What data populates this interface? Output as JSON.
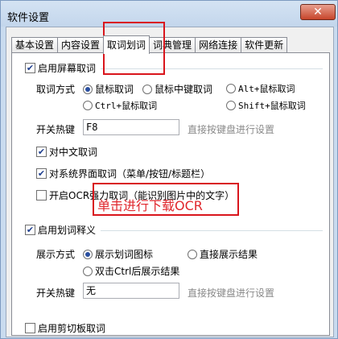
{
  "window": {
    "title": "软件设置",
    "close_glyph": "✕"
  },
  "tabs": [
    {
      "label": "基本设置"
    },
    {
      "label": "内容设置"
    },
    {
      "label": "取词划词"
    },
    {
      "label": "词典管理"
    },
    {
      "label": "网络连接"
    },
    {
      "label": "软件更新"
    }
  ],
  "screen_capture": {
    "enable_label": "启用屏幕取词",
    "mode_label": "取词方式",
    "options": [
      {
        "label": "鼠标取词"
      },
      {
        "label": "鼠标中键取词"
      },
      {
        "label": "Alt+鼠标取词"
      },
      {
        "label": "Ctrl+鼠标取词"
      },
      {
        "label": "Shift+鼠标取词"
      }
    ],
    "hotkey_label": "开关热键",
    "hotkey_value": "F8",
    "hotkey_hint": "直接按键盘进行设置",
    "cb_chinese": "对中文取词",
    "cb_ui": "对系统界面取词（菜单/按钮/标题栏）",
    "cb_ocr": "开启OCR强力取词（能识别图片中的文字）"
  },
  "selection": {
    "enable_label": "启用划词释义",
    "mode_label": "展示方式",
    "options": [
      {
        "label": "展示划词图标"
      },
      {
        "label": "直接展示结果"
      },
      {
        "label": "双击Ctrl后展示结果"
      }
    ],
    "hotkey_label": "开关热键",
    "hotkey_value": "无",
    "hotkey_hint": "直接按键盘进行设置"
  },
  "clipboard": {
    "enable_label": "启用剪切板取词"
  },
  "annotation": {
    "text": "单击进行下载OCR"
  },
  "check_glyph": "✔"
}
